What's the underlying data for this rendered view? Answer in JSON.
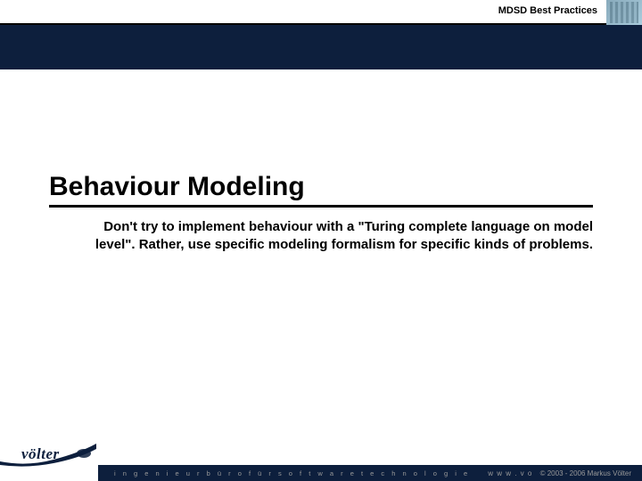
{
  "header": {
    "title": "MDSD Best Practices"
  },
  "content": {
    "title": "Behaviour Modeling",
    "subtitle": "Don't try to implement behaviour with a \"Turing complete language on model level\". Rather, use specific modeling formalism for specific kinds of problems."
  },
  "footer": {
    "logo_text": "völter",
    "tagline": "i n g e n i e u r b ü r o   f ü r   s o f t w a r e t e c h n o l o g i e",
    "weblink": "w w w . v o",
    "copyright": "© 2003 - 2006 Markus Völter"
  }
}
